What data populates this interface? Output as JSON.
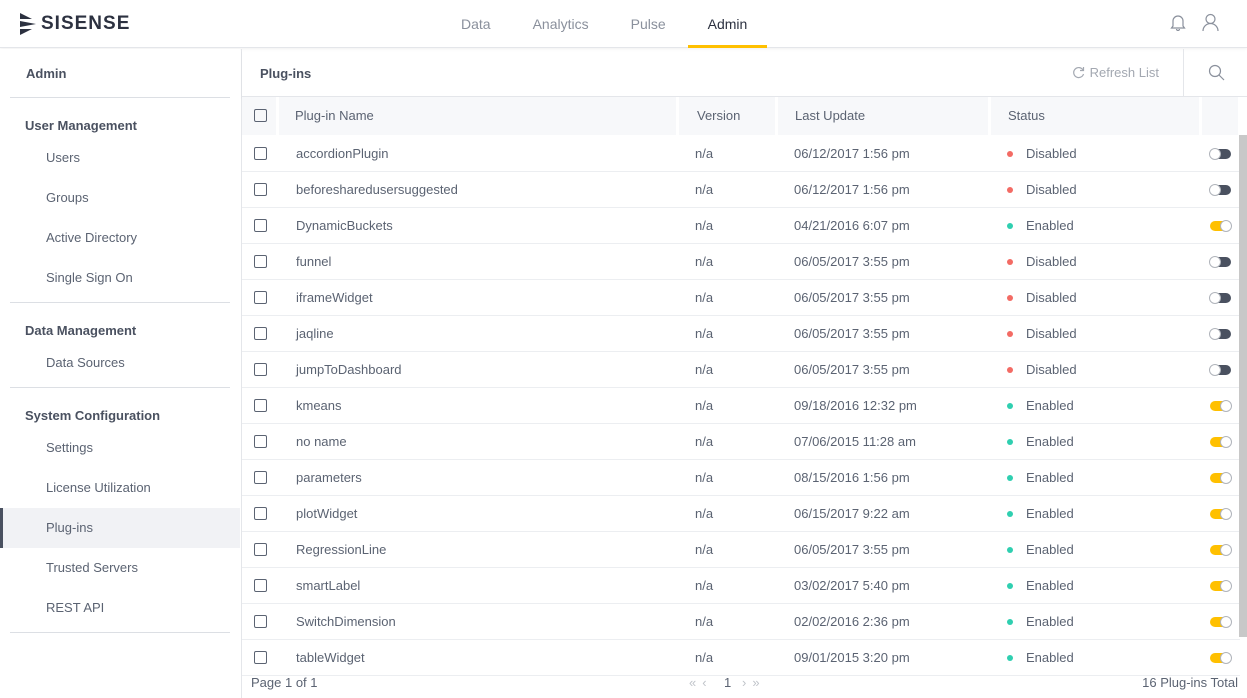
{
  "brand": "SISENSE",
  "nav": [
    "Data",
    "Analytics",
    "Pulse",
    "Admin"
  ],
  "nav_active": "Admin",
  "sidebar": {
    "title": "Admin",
    "groups": [
      {
        "title": "User Management",
        "items": [
          "Users",
          "Groups",
          "Active Directory",
          "Single Sign On"
        ]
      },
      {
        "title": "Data Management",
        "items": [
          "Data Sources"
        ]
      },
      {
        "title": "System Configuration",
        "items": [
          "Settings",
          "License Utilization",
          "Plug-ins",
          "Trusted Servers",
          "REST API"
        ]
      }
    ],
    "selected": "Plug-ins"
  },
  "main": {
    "title": "Plug-ins",
    "refresh": "Refresh List",
    "columns": [
      "Plug-in Name",
      "Version",
      "Last Update",
      "Status"
    ],
    "rows": [
      {
        "name": "accordionPlugin",
        "version": "n/a",
        "updated": "06/12/2017 1:56 pm",
        "status": "Disabled"
      },
      {
        "name": "beforesharedusersuggested",
        "version": "n/a",
        "updated": "06/12/2017 1:56 pm",
        "status": "Disabled"
      },
      {
        "name": "DynamicBuckets",
        "version": "n/a",
        "updated": "04/21/2016 6:07 pm",
        "status": "Enabled"
      },
      {
        "name": "funnel",
        "version": "n/a",
        "updated": "06/05/2017 3:55 pm",
        "status": "Disabled"
      },
      {
        "name": "iframeWidget",
        "version": "n/a",
        "updated": "06/05/2017 3:55 pm",
        "status": "Disabled"
      },
      {
        "name": "jaqline",
        "version": "n/a",
        "updated": "06/05/2017 3:55 pm",
        "status": "Disabled"
      },
      {
        "name": "jumpToDashboard",
        "version": "n/a",
        "updated": "06/05/2017 3:55 pm",
        "status": "Disabled"
      },
      {
        "name": "kmeans",
        "version": "n/a",
        "updated": "09/18/2016 12:32 pm",
        "status": "Enabled"
      },
      {
        "name": "no name",
        "version": "n/a",
        "updated": "07/06/2015 11:28 am",
        "status": "Enabled"
      },
      {
        "name": "parameters",
        "version": "n/a",
        "updated": "08/15/2016 1:56 pm",
        "status": "Enabled"
      },
      {
        "name": "plotWidget",
        "version": "n/a",
        "updated": "06/15/2017 9:22 am",
        "status": "Enabled"
      },
      {
        "name": "RegressionLine",
        "version": "n/a",
        "updated": "06/05/2017 3:55 pm",
        "status": "Enabled"
      },
      {
        "name": "smartLabel",
        "version": "n/a",
        "updated": "03/02/2017 5:40 pm",
        "status": "Enabled"
      },
      {
        "name": "SwitchDimension",
        "version": "n/a",
        "updated": "02/02/2016 2:36 pm",
        "status": "Enabled"
      },
      {
        "name": "tableWidget",
        "version": "n/a",
        "updated": "09/01/2015 3:20 pm",
        "status": "Enabled"
      }
    ],
    "page_info": "Page 1 of 1",
    "page": "1",
    "total": "16 Plug-ins Total"
  },
  "colors": {
    "accent": "#ffc000",
    "enabled": "#2fcfb0",
    "disabled": "#f36b64",
    "toggle_off": "#4a5160"
  }
}
